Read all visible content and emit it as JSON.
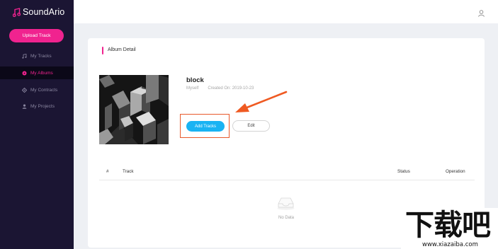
{
  "app": {
    "name": "SoundArio",
    "brand_color": "#f0238f",
    "sidebar_bg": "#1b1533",
    "accent_blue": "#19b3f3"
  },
  "sidebar": {
    "upload_label": "Upload Track",
    "items": [
      {
        "label": "My Tracks",
        "icon": "music-note-icon",
        "active": false
      },
      {
        "label": "My Albums",
        "icon": "album-disc-icon",
        "active": true
      },
      {
        "label": "My Contracts",
        "icon": "contract-icon",
        "active": false
      },
      {
        "label": "My Projects",
        "icon": "user-icon",
        "active": false
      }
    ]
  },
  "header": {
    "user_icon": "user-account-icon"
  },
  "album": {
    "section_title": "Album Detail",
    "name": "block",
    "owner": "Myself",
    "created": "Created On: 2019-10-23",
    "add_tracks_label": "Add Tracks",
    "edit_label": "Edit"
  },
  "table": {
    "columns": [
      "#",
      "Track",
      "Status",
      "Operation"
    ],
    "rows": [],
    "empty_text": "No Data"
  },
  "watermark": {
    "main": "下载吧",
    "url": "www.xiazaiba.com"
  }
}
